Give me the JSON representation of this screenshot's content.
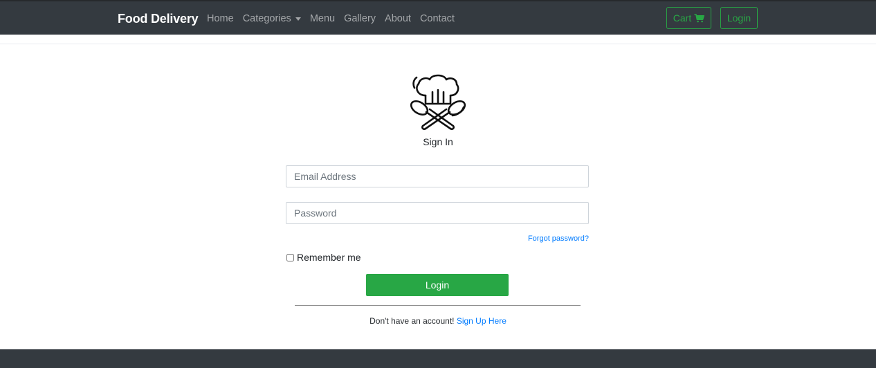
{
  "navbar": {
    "brand": "Food Delivery",
    "links": [
      "Home",
      "Categories",
      "Menu",
      "Gallery",
      "About",
      "Contact"
    ],
    "cart_label": "Cart",
    "cart_icon": "shopping-cart-icon",
    "login_label": "Login"
  },
  "login_form": {
    "logo_icon": "chef-hat-spoons-icon",
    "title": "Sign In",
    "email_placeholder": "Email Address",
    "password_placeholder": "Password",
    "forgot_password": "Forgot password?",
    "remember_me": "Remember me",
    "remember_checked": false,
    "submit_label": "Login",
    "no_account_text": "Don't have an account!",
    "signup_link": "Sign Up Here"
  },
  "colors": {
    "navbar_bg": "#343a40",
    "accent_green": "#28a745",
    "link_blue": "#007bff"
  }
}
